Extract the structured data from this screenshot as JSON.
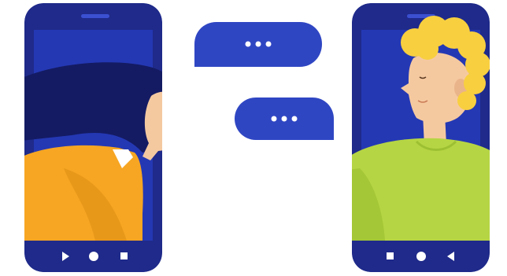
{
  "scene": {
    "description": "",
    "colors": {
      "background": "#ffffff",
      "phone_body": "#1f2a8a",
      "phone_screen": "#2438b4",
      "bubble": "#2f46c3",
      "woman_hair": "#141b63",
      "woman_sweater": "#f6a623",
      "woman_skin": "#f5c9a0",
      "man_hair": "#f8cf3f",
      "man_shirt": "#b6d544",
      "man_skin": "#f5c9a0",
      "ui_icon": "#ffffff"
    }
  },
  "left_phone": {
    "nav_icons": [
      "play-icon",
      "home-circle-icon",
      "stop-square-icon"
    ]
  },
  "right_phone": {
    "nav_icons": [
      "stop-square-icon",
      "home-circle-icon",
      "back-triangle-icon"
    ]
  },
  "bubbles": [
    {
      "content": "typing-dots"
    },
    {
      "content": "typing-dots"
    }
  ]
}
